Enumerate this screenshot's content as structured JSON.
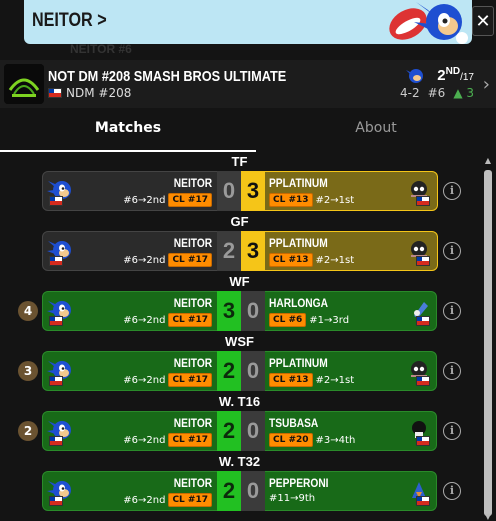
{
  "banner": {
    "player_name": "NEITOR",
    "chevron": ">"
  },
  "ghost_text": "NEITOR #6",
  "tournament": {
    "name": "NOT DM #208 SMASH BROS ULTIMATE",
    "short": "NDM #208",
    "placement": "2",
    "placement_suffix": "ND",
    "placement_total": "/17",
    "seed_record": "4-2",
    "seed": "#6",
    "delta": "▲ 3"
  },
  "tabs": [
    {
      "label": "Matches",
      "active": true
    },
    {
      "label": "About",
      "active": false
    }
  ],
  "matches": [
    {
      "round": "TF",
      "badge": "",
      "result": "loss",
      "p1": {
        "name": "NEITOR",
        "seed": "#6→2nd",
        "cl": "CL #17",
        "score": "0"
      },
      "p2": {
        "name": "PPLATINUM",
        "seed": "#2→1st",
        "cl": "CL #13",
        "score": "3"
      }
    },
    {
      "round": "GF",
      "badge": "",
      "result": "loss",
      "p1": {
        "name": "NEITOR",
        "seed": "#6→2nd",
        "cl": "CL #17",
        "score": "2"
      },
      "p2": {
        "name": "PPLATINUM",
        "seed": "#2→1st",
        "cl": "CL #13",
        "score": "3"
      }
    },
    {
      "round": "WF",
      "badge": "4",
      "result": "win",
      "p1": {
        "name": "NEITOR",
        "seed": "#6→2nd",
        "cl": "CL #17",
        "score": "3"
      },
      "p2": {
        "name": "HARLONGA",
        "seed": "#1→3rd",
        "cl": "CL #6",
        "score": "0"
      }
    },
    {
      "round": "WSF",
      "badge": "3",
      "result": "win",
      "p1": {
        "name": "NEITOR",
        "seed": "#6→2nd",
        "cl": "CL #17",
        "score": "2"
      },
      "p2": {
        "name": "PPLATINUM",
        "seed": "#2→1st",
        "cl": "CL #13",
        "score": "0"
      }
    },
    {
      "round": "W. T16",
      "badge": "2",
      "result": "win",
      "p1": {
        "name": "NEITOR",
        "seed": "#6→2nd",
        "cl": "CL #17",
        "score": "2"
      },
      "p2": {
        "name": "TSUBASA",
        "seed": "#3→4th",
        "cl": "CL #20",
        "score": "0"
      }
    },
    {
      "round": "W. T32",
      "badge": "",
      "result": "win",
      "p1": {
        "name": "NEITOR",
        "seed": "#6→2nd",
        "cl": "CL #17",
        "score": "2"
      },
      "p2": {
        "name": "PEPPERONI",
        "seed": "#11→9th",
        "cl": "",
        "score": "0"
      }
    }
  ],
  "icons": {
    "close": "close-icon",
    "info": "info-icon",
    "chevron": "chevron-right-icon"
  },
  "colors": {
    "win": "#186a18",
    "gold": "#f5c518",
    "cl_badge": "#ff8c00",
    "banner": "#bde6f4"
  }
}
